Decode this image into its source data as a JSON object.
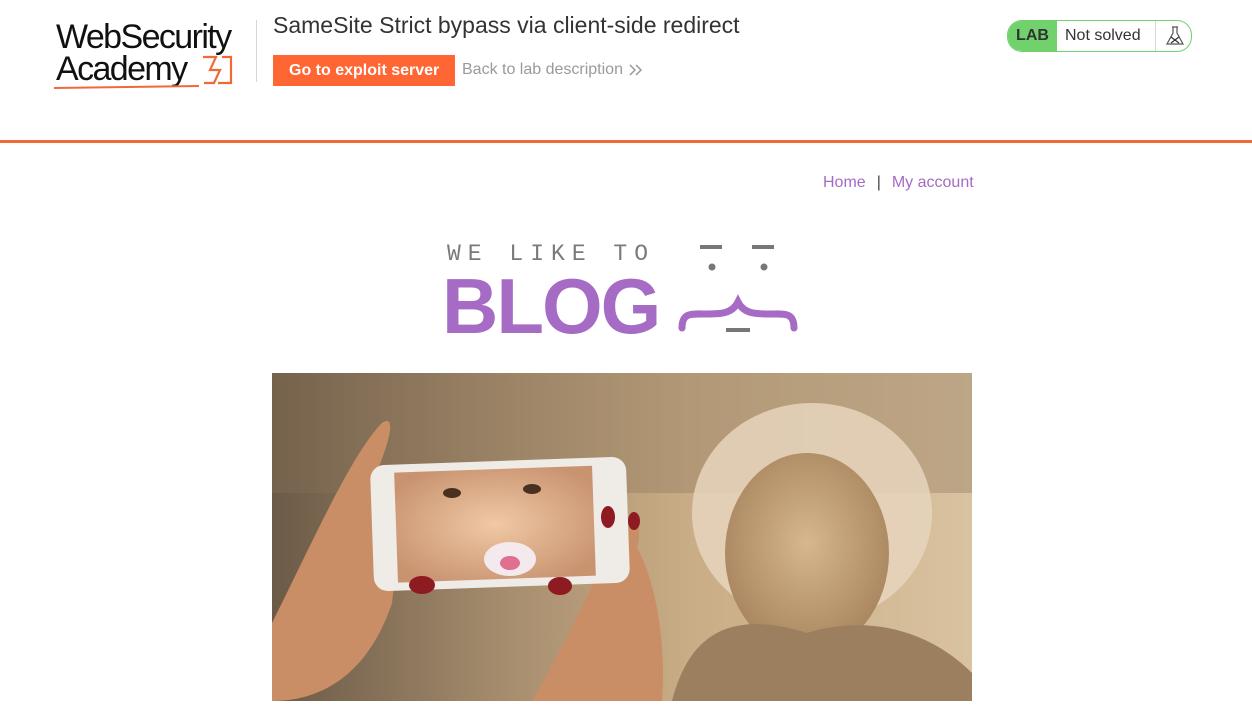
{
  "academy": {
    "logo_line1": "WebSecurity",
    "logo_line2": "Academy",
    "lab_title": "SameSite Strict bypass via client-side redirect",
    "exploit_button": "Go to exploit server",
    "back_link": "Back to lab description",
    "status_badge": "LAB",
    "status_text": "Not solved",
    "icons": [
      "bolt-icon",
      "chevrons-right-icon",
      "flask-icon"
    ],
    "colors": {
      "accent": "#ff6633",
      "solved_green": "#70d16d",
      "link_purple": "#a66bc4"
    }
  },
  "nav": {
    "home": "Home",
    "separator": "|",
    "my_account": "My account"
  },
  "banner": {
    "small_text": "WE LIKE TO",
    "big_text": "BLOG"
  },
  "post": {
    "image_description_icon": "blog-post-image"
  }
}
